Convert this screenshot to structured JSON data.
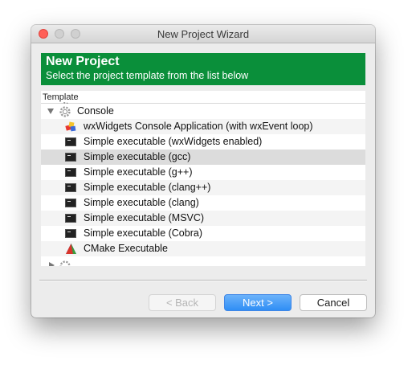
{
  "window": {
    "title": "New Project Wizard"
  },
  "banner": {
    "title": "New Project",
    "subtitle": "Select the project template from the list below"
  },
  "list": {
    "header": "Template",
    "group": {
      "label": "Console",
      "icon": "gear-icon",
      "expanded": true
    },
    "items": [
      {
        "label": "wxWidgets Console Application (with wxEvent loop)",
        "icon": "wxwidgets-icon"
      },
      {
        "label": "Simple executable (wxWidgets enabled)",
        "icon": "terminal-icon"
      },
      {
        "label": "Simple executable (gcc)",
        "icon": "terminal-icon",
        "selected": true
      },
      {
        "label": "Simple executable (g++)",
        "icon": "terminal-icon"
      },
      {
        "label": "Simple executable (clang++)",
        "icon": "terminal-icon"
      },
      {
        "label": "Simple executable (clang)",
        "icon": "terminal-icon"
      },
      {
        "label": "Simple executable (MSVC)",
        "icon": "terminal-icon"
      },
      {
        "label": "Simple executable (Cobra)",
        "icon": "terminal-icon"
      },
      {
        "label": "CMake Executable",
        "icon": "cmake-icon"
      }
    ]
  },
  "buttons": {
    "back": "< Back",
    "next": "Next >",
    "cancel": "Cancel"
  },
  "colors": {
    "banner": "#0a8f3a",
    "next_button": "#2f8ef5",
    "close_light": "#ff5f57"
  }
}
